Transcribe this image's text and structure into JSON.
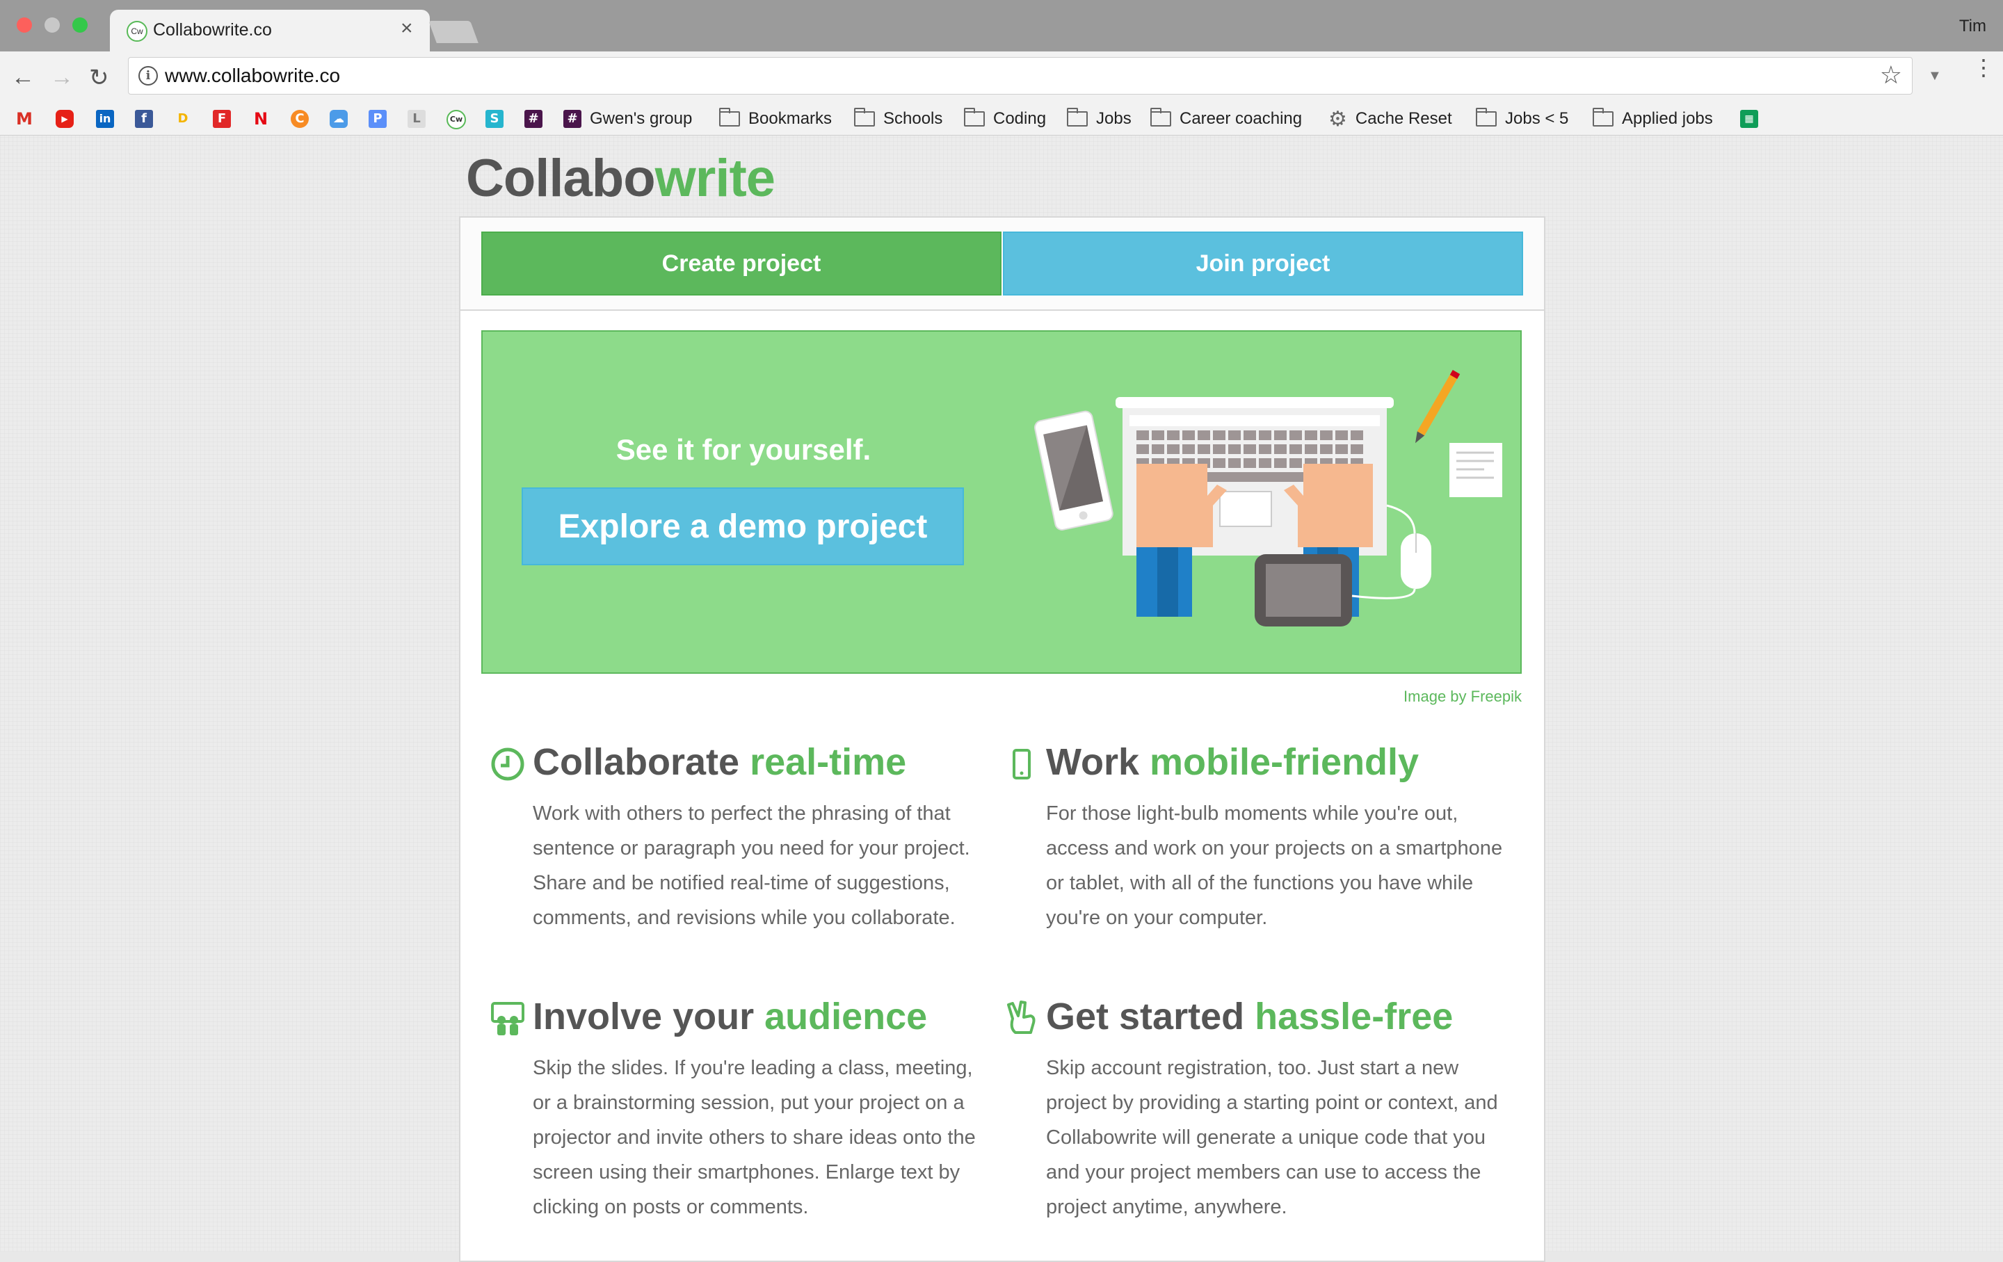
{
  "browser": {
    "tab_title": "Collabowrite.co",
    "tab_favicon_text": "Cw",
    "tab_close": "×",
    "user_name": "Tim",
    "url": "www.collabowrite.co",
    "bookmarks": [
      {
        "label": "Gwen's group",
        "icon": "slack-icon"
      },
      {
        "label": "Bookmarks",
        "icon": "folder-icon"
      },
      {
        "label": "Schools",
        "icon": "folder-icon"
      },
      {
        "label": "Coding",
        "icon": "folder-icon"
      },
      {
        "label": "Jobs",
        "icon": "folder-icon"
      },
      {
        "label": "Career coaching",
        "icon": "folder-icon"
      },
      {
        "label": "Cache Reset",
        "icon": "gear-icon"
      },
      {
        "label": "Jobs < 5",
        "icon": "folder-icon"
      },
      {
        "label": "Applied jobs",
        "icon": "folder-icon"
      }
    ],
    "icon_bookmarks": [
      "gmail-icon",
      "youtube-icon",
      "linkedin-icon",
      "facebook-icon",
      "d-icon",
      "flipboard-icon",
      "netflix-icon",
      "crunchyroll-icon",
      "cloud-icon",
      "p-icon",
      "l-icon",
      "collabowrite-icon",
      "s-icon",
      "slack-icon"
    ],
    "colors": {
      "tabstrip": "#9b9b9b",
      "toolbar": "#f2f2f2"
    }
  },
  "site": {
    "logo_part1": "Collabo",
    "logo_part2": "write",
    "create_button": "Create project",
    "join_button": "Join project",
    "banner_heading": "See it for yourself.",
    "demo_button": "Explore a demo project",
    "image_credit": "Image by Freepik",
    "colors": {
      "green": "#5cb85c",
      "blue": "#5bc0de",
      "banner": "#8ddb8a"
    }
  },
  "features": [
    {
      "icon": "clock-icon",
      "title_plain": "Collaborate ",
      "title_accent": "real-time",
      "body": "Work with others to perfect the phrasing of that sentence or paragraph you need for your project. Share and be notified real-time of suggestions, comments, and revisions while you collaborate."
    },
    {
      "icon": "mobile-icon",
      "title_plain": "Work ",
      "title_accent": "mobile-friendly",
      "body": "For those light-bulb moments while you're out, access and work on your projects on a smartphone or tablet, with all of the functions you have while you're on your computer."
    },
    {
      "icon": "presentation-audience-icon",
      "title_plain": "Involve your ",
      "title_accent": "audience",
      "body": "Skip the slides. If you're leading a class, meeting, or a brainstorming session, put your project on a projector and invite others to share ideas onto the screen using their smartphones. Enlarge text by clicking on posts or comments."
    },
    {
      "icon": "peace-hand-icon",
      "title_plain": "Get started ",
      "title_accent": "hassle-free",
      "body": "Skip account registration, too. Just start a new project by providing a starting point or context, and Collabowrite will generate a unique code that you and your project members can use to access the project anytime, anywhere."
    }
  ]
}
